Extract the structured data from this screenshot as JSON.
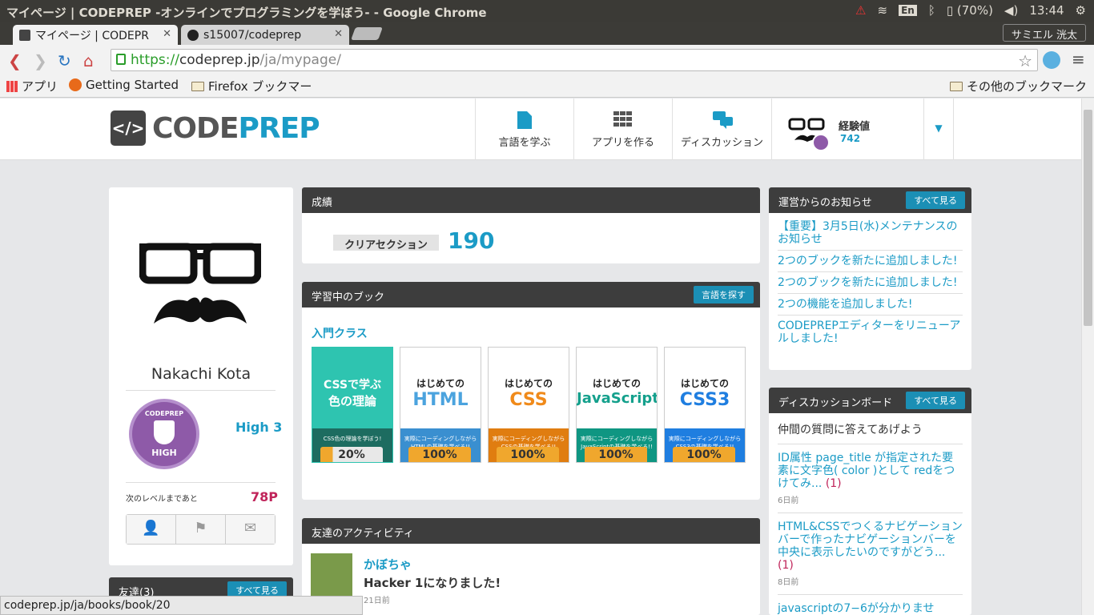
{
  "os": {
    "window_title": "マイページ | CODEPREP -オンラインでプログラミングを学ぼう- - Google Chrome",
    "input_method": "En",
    "battery": "(70%)",
    "clock": "13:44"
  },
  "browser": {
    "tabs": [
      {
        "label": "マイページ | CODEPR"
      },
      {
        "label": "s15007/codeprep"
      }
    ],
    "profile_name": "サミエル 洸太",
    "url_scheme": "https://",
    "url_host": "codeprep.jp",
    "url_path": "/ja/mypage/",
    "bookmarks": [
      "アプリ",
      "Getting Started",
      "Firefox ブックマー",
      "その他のブックマーク"
    ],
    "status_url": "codeprep.jp/ja/books/book/20"
  },
  "site": {
    "logo_a": "CODE",
    "logo_b": "PREP",
    "nav": [
      {
        "label": "言語を学ぶ"
      },
      {
        "label": "アプリを作る"
      },
      {
        "label": "ディスカッション"
      }
    ],
    "exp_label": "経験値",
    "exp_value": "742"
  },
  "profile": {
    "name": "Nakachi Kota",
    "badge_top": "CODEPREP",
    "badge_bottom": "HIGH",
    "level": "High 3",
    "next_level_label": "次のレベルまであと",
    "next_level_points": "78P",
    "friends_title": "友達(3)",
    "friends_button": "すべて見る"
  },
  "results": {
    "title": "成績",
    "clear_label": "クリアセクション",
    "clear_value": "190"
  },
  "books": {
    "title": "学習中のブック",
    "button": "言語を探す",
    "class_label": "入門クラス",
    "items": [
      {
        "top": "CSSで学ぶ",
        "main": "色の理論",
        "sub": "CSS色の理論を学ぼう!",
        "progress": "20%",
        "color": "#2ec4b0",
        "band": "#1d6c60"
      },
      {
        "top": "はじめての",
        "main": "HTML",
        "sub": "実際にコーディングしながらHTMLの基礎を学べる!!",
        "progress": "100%",
        "color": "#4ba3de",
        "band": "#3a8fd0"
      },
      {
        "top": "はじめての",
        "main": "CSS",
        "sub": "実際にコーディングしながらCSSの基礎を学べる!!",
        "progress": "100%",
        "color": "#f08a1a",
        "band": "#e07d10"
      },
      {
        "top": "はじめての",
        "main": "JavaScript",
        "sub": "実際にコーディングしながらJavaScriptの基礎を学べる!!",
        "progress": "100%",
        "color": "#14a08c",
        "band": "#0f9682"
      },
      {
        "top": "はじめての",
        "main": "CSS3",
        "sub": "実際にコーディングしながらCSS3の基礎を学べる!!",
        "progress": "100%",
        "color": "#1f7ee0",
        "band": "#1f7ee0"
      }
    ]
  },
  "activity": {
    "title": "友達のアクティビティ",
    "user": "かぼちゃ",
    "message": "Hacker 1になりました!",
    "time": "21日前"
  },
  "news": {
    "title": "運営からのお知らせ",
    "button": "すべて見る",
    "items": [
      "【重要】3月5日(水)メンテナンスのお知らせ",
      "2つのブックを新たに追加しました!",
      "2つのブックを新たに追加しました!",
      "2つの機能を追加しました!",
      "CODEPREPエディターをリニューアルしました!"
    ]
  },
  "discussion": {
    "title": "ディスカッションボード",
    "button": "すべて見る",
    "intro": "仲間の質問に答えてあげよう",
    "items": [
      {
        "text": "ID属性 page_title が指定された要素に文字色( color )として redをつけてみ...",
        "count": "(1)",
        "time": "6日前"
      },
      {
        "text": "HTML&CSSでつくるナビゲーションバーで作ったナビゲーションバーを中央に表示したいのですがどう...",
        "count": "(1)",
        "time": "8日前"
      },
      {
        "text": "javascriptの7−6が分かりませ",
        "count": "",
        "time": ""
      }
    ]
  }
}
